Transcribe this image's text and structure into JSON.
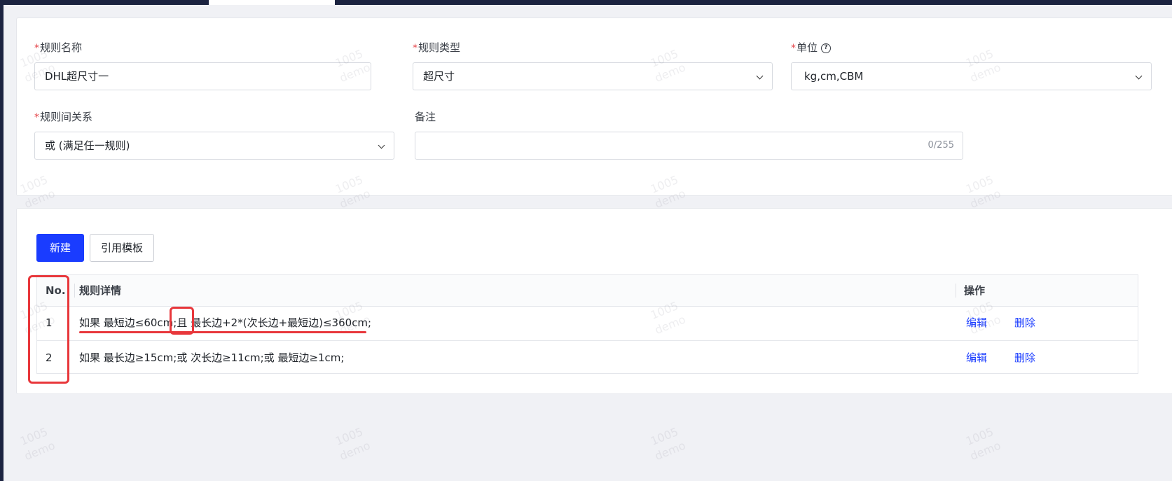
{
  "form": {
    "rule_name": {
      "label": "规则名称",
      "required_mark": "*",
      "value": "DHL超尺寸一"
    },
    "rule_type": {
      "label": "规则类型",
      "required_mark": "*",
      "value": "超尺寸"
    },
    "unit": {
      "label": "单位",
      "required_mark": "*",
      "help_glyph": "?",
      "value": "kg,cm,CBM"
    },
    "rule_relation": {
      "label": "规则间关系",
      "required_mark": "*",
      "value": "或 (满足任一规则)"
    },
    "remark": {
      "label": "备注",
      "value": "",
      "counter": "0/255"
    }
  },
  "toolbar": {
    "new_label": "新建",
    "template_label": "引用模板"
  },
  "table": {
    "headers": {
      "no": "No.",
      "detail": "规则详情",
      "actions": "操作"
    },
    "rows": [
      {
        "no": "1",
        "detail": "如果 最短边≤60cm;且 最长边+2*(次长边+最短边)≤360cm;",
        "edit": "编辑",
        "delete": "删除"
      },
      {
        "no": "2",
        "detail": "如果 最长边≥15cm;或 次长边≥11cm;或 最短边≥1cm;",
        "edit": "编辑",
        "delete": "删除"
      }
    ]
  },
  "watermark": {
    "line1": "1005",
    "line2": "demo"
  },
  "colors": {
    "primary": "#1a3cff",
    "annotation": "#e8373b",
    "required": "#e5484d",
    "nav_dark": "#1b2340"
  }
}
